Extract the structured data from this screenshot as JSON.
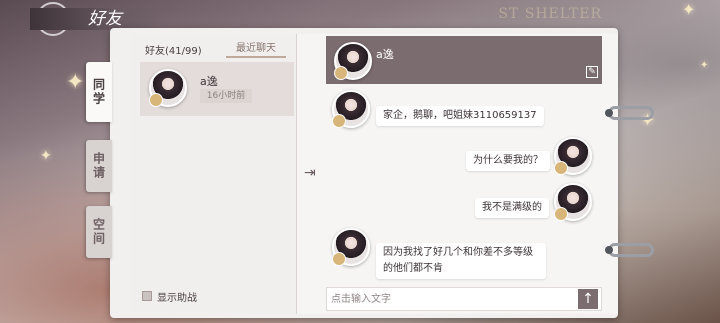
{
  "screen": {
    "title": "好友",
    "brand": "ST SHELTER"
  },
  "side_tabs": [
    {
      "label": "同学",
      "active": true
    },
    {
      "label": "申请",
      "active": false
    },
    {
      "label": "空间",
      "active": false
    }
  ],
  "friends_panel": {
    "count_label": "好友(41/99)",
    "recent_tab": "最近聊天",
    "friend": {
      "name": "a逸",
      "time": "16小时前"
    },
    "assist_label": "显示助战"
  },
  "chat": {
    "partner_name": "a逸",
    "messages": [
      {
        "from": "them",
        "text": "家企，鹅聊，吧姐妹3110659137"
      },
      {
        "from": "me",
        "text": "为什么要我的？"
      },
      {
        "from": "me",
        "text": "我不是满级的"
      },
      {
        "from": "them",
        "text": "因为我找了好几个和你差不多等级的他们都不肯"
      }
    ],
    "input_placeholder": "点击输入文字",
    "send_icon": "arrow-up-icon",
    "collapse_icon": "collapse-panel-icon",
    "edit_icon": "edit-icon"
  },
  "colors": {
    "header": "#7b6c70",
    "page": "#f6f5f4",
    "accent": "#bfa99a"
  }
}
